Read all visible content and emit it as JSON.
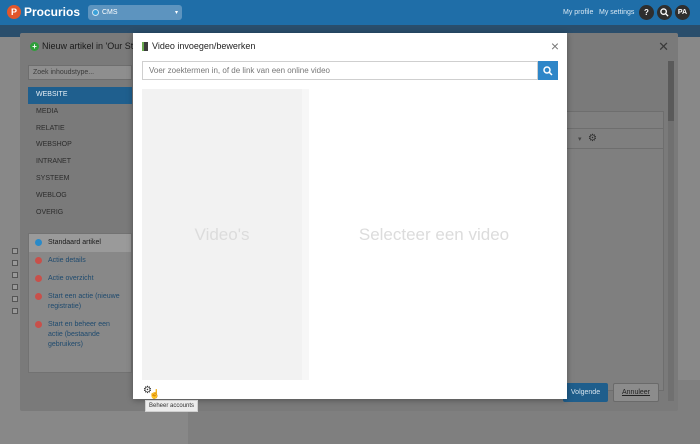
{
  "app": {
    "brand": "Procurios",
    "site_select": "CMS",
    "my_profile": "My profile",
    "my_settings": "My settings",
    "help": "?",
    "avatar": "PA"
  },
  "outer_dialog": {
    "title": "Nieuw artikel in 'Our St",
    "search_placeholder": "Zoek inhoudstype...",
    "categories": [
      "WEBSITE",
      "MEDIA",
      "RELATIE",
      "WEBSHOP",
      "INTRANET",
      "SYSTEEM",
      "WEBLOG",
      "OVERIG"
    ],
    "types": [
      "Standaard artikel",
      "Actie details",
      "Actie overzicht",
      "Start een actie (nieuwe registratie)",
      "Start en beheer een actie (bestaande gebruikers)"
    ],
    "next_label": "Volgende",
    "cancel_label": "Annuleer"
  },
  "video_modal": {
    "title": "Video invoegen/bewerken",
    "search_placeholder": "Voer zoektermen in, of de link van een online video",
    "left_pane_label": "Video's",
    "right_pane_label": "Selecteer een video",
    "tooltip": "Beheer accounts"
  }
}
